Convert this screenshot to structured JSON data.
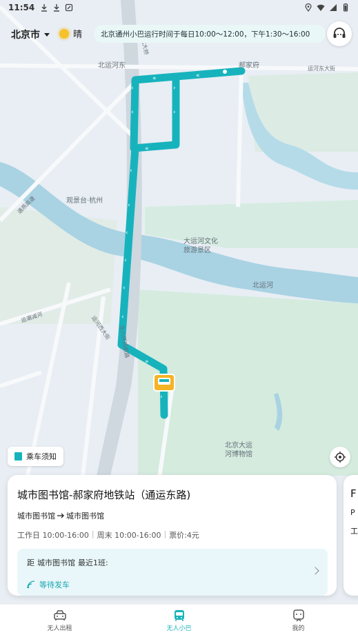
{
  "status_bar": {
    "time": "11:54",
    "left_icons": [
      "download-icon",
      "download-icon",
      "nfc-icon"
    ],
    "right_icons": [
      "location-icon",
      "wifi-icon",
      "signal-icon",
      "battery-icon"
    ]
  },
  "header": {
    "city": "北京市",
    "weather": "晴",
    "notice": "北京通州小巴运行时间于每日10:00～12:00，下午1:30～16:00"
  },
  "map": {
    "labels": {
      "road_north": "北运河东",
      "haojiafu": "郝家府",
      "road_east": "运河东大街",
      "guanjing": "观景台·杭州",
      "scenic": "大运河文化\n旅游景区",
      "river": "北运河",
      "museum": "北京大运\n河博物馆",
      "road_west": "运河西大街",
      "road_south": "东六环西侧路",
      "road_sw": "通燕高速",
      "road_bridge": "北大桥",
      "road_w2": "运潮减河"
    },
    "route_color": "#17b3bd"
  },
  "ride_notice": "乘车须知",
  "route_card": {
    "title": "城市图书馆-郝家府地铁站（通运东路)",
    "from": "城市图书馆",
    "to": "城市图书馆",
    "hours_weekday": "工作日 10:00-16:00",
    "hours_weekend": "周末 10:00-16:00",
    "fare": "票价:4元",
    "next_prefix": "距",
    "next_stop": "城市图书馆",
    "next_suffix": "最近1班:",
    "next_status": "等待发车"
  },
  "route_card_peek": {
    "title": "F",
    "line": "P",
    "hours": "工"
  },
  "bottom_nav": {
    "items": [
      {
        "label": "无人出租",
        "icon": "taxi-icon"
      },
      {
        "label": "无人小巴",
        "icon": "bus-icon"
      },
      {
        "label": "我的",
        "icon": "profile-icon"
      }
    ],
    "active_index": 1
  }
}
